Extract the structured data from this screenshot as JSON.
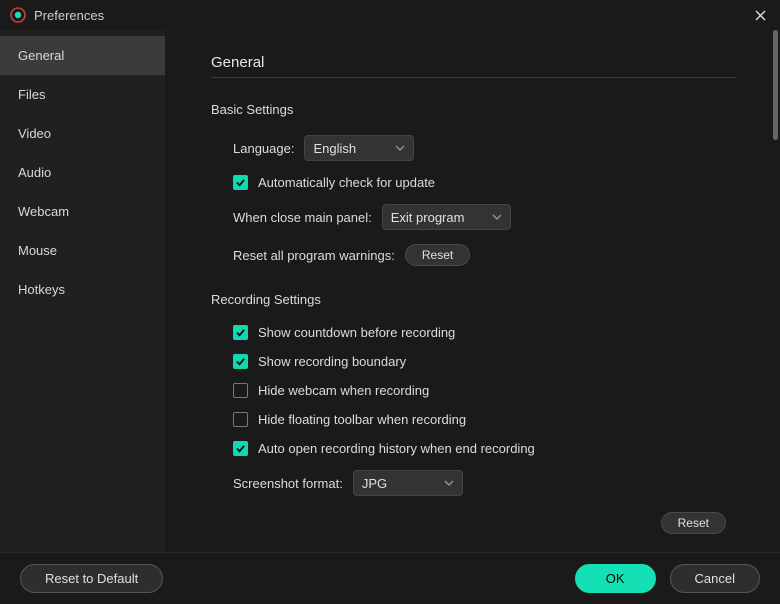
{
  "window": {
    "title": "Preferences"
  },
  "sidebar": {
    "items": [
      {
        "label": "General",
        "active": true
      },
      {
        "label": "Files",
        "active": false
      },
      {
        "label": "Video",
        "active": false
      },
      {
        "label": "Audio",
        "active": false
      },
      {
        "label": "Webcam",
        "active": false
      },
      {
        "label": "Mouse",
        "active": false
      },
      {
        "label": "Hotkeys",
        "active": false
      }
    ]
  },
  "page": {
    "title": "General",
    "basic": {
      "heading": "Basic Settings",
      "language_label": "Language:",
      "language_value": "English",
      "auto_update_label": "Automatically check for update",
      "auto_update_checked": true,
      "close_panel_label": "When close main panel:",
      "close_panel_value": "Exit program",
      "reset_warnings_label": "Reset all program warnings:",
      "reset_button": "Reset"
    },
    "recording": {
      "heading": "Recording Settings",
      "show_countdown_label": "Show countdown before recording",
      "show_countdown_checked": true,
      "show_boundary_label": "Show recording boundary",
      "show_boundary_checked": true,
      "hide_webcam_label": "Hide webcam when recording",
      "hide_webcam_checked": false,
      "hide_toolbar_label": "Hide floating toolbar when recording",
      "hide_toolbar_checked": false,
      "auto_open_history_label": "Auto open recording history when end recording",
      "auto_open_history_checked": true,
      "screenshot_format_label": "Screenshot format:",
      "screenshot_format_value": "JPG",
      "reset_button": "Reset"
    }
  },
  "footer": {
    "reset_default": "Reset to Default",
    "ok": "OK",
    "cancel": "Cancel"
  }
}
